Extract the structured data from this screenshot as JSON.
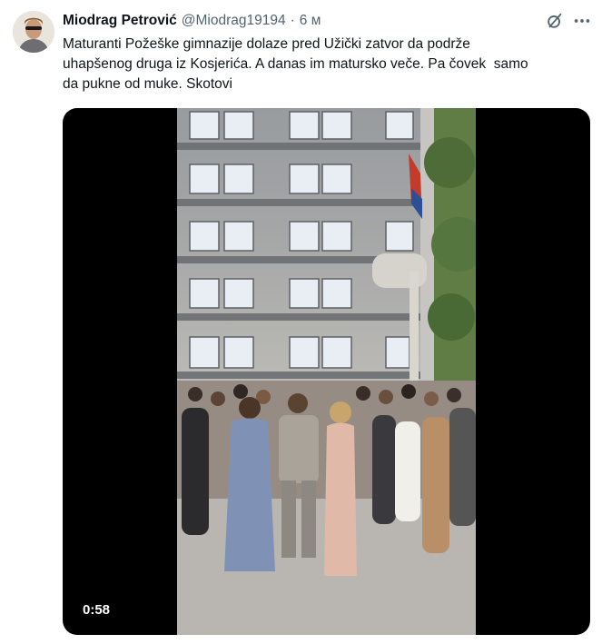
{
  "tweet": {
    "author_name": "Miodrag Petrović",
    "handle": "@Miodrag19194",
    "separator": "·",
    "time": "6 м",
    "text": "Maturanti Požeške gimnazije dolaze pred Užički zatvor da podrže\nuhapšenog druga iz Kosjerića. A danas im matursko veče. Pa čovek  samo\nda pukne od muke. Skotovi"
  },
  "media": {
    "duration": "0:58"
  },
  "icons": {
    "grok": "grok-icon",
    "more": "more-horizontal-icon",
    "avatar": "avatar"
  },
  "colors": {
    "primary_text": "#0f1419",
    "secondary_text": "#536471",
    "media_background": "#000000"
  }
}
